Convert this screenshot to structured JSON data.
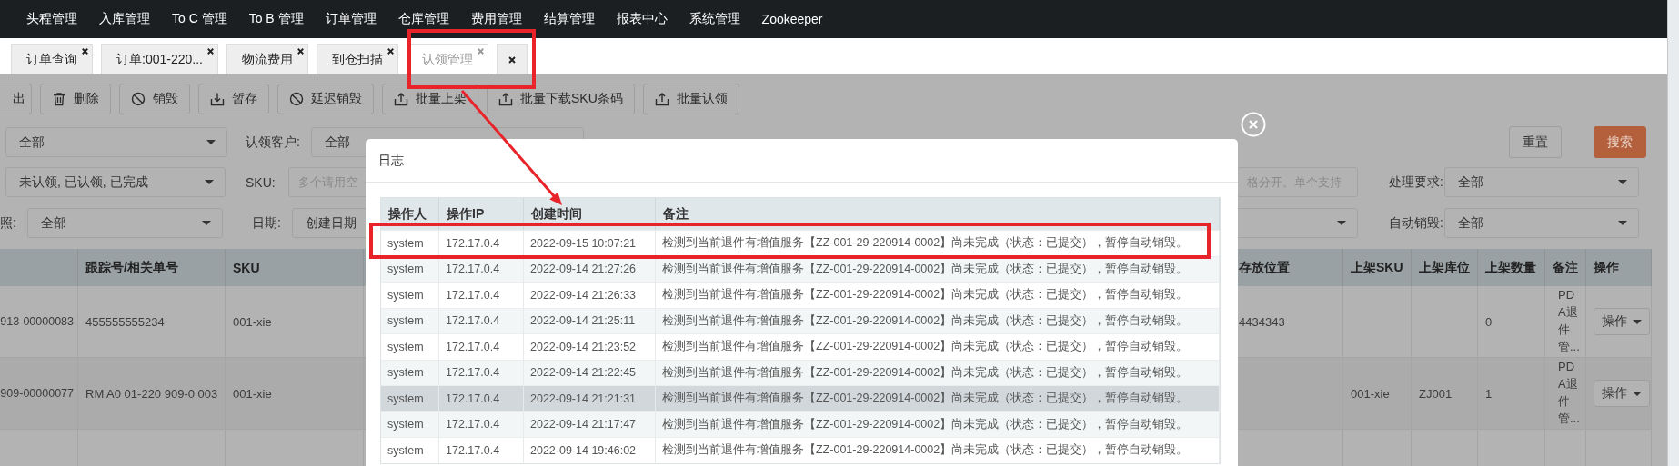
{
  "nav": {
    "items": [
      "头程管理",
      "入库管理",
      "To C 管理",
      "To B 管理",
      "订单管理",
      "仓库管理",
      "费用管理",
      "结算管理",
      "报表中心",
      "系统管理",
      "Zookeeper"
    ]
  },
  "tabs": [
    {
      "label": "订单查询",
      "selected": false
    },
    {
      "label": "订单:001-220...",
      "selected": false
    },
    {
      "label": "物流费用",
      "selected": false
    },
    {
      "label": "到仓扫描",
      "selected": false
    },
    {
      "label": "认领管理",
      "selected": true
    },
    {
      "selected": false
    }
  ],
  "toolbar": {
    "buttons": [
      {
        "label": "出",
        "kind": "plain"
      },
      {
        "label": "删除",
        "kind": "trash"
      },
      {
        "label": "销毁",
        "kind": "ban"
      },
      {
        "label": "暂存",
        "kind": "download"
      },
      {
        "label": "延迟销毁",
        "kind": "ban"
      },
      {
        "label": "批量上架",
        "kind": "upload"
      },
      {
        "label": "批量下载SKU条码",
        "kind": "upload"
      },
      {
        "label": "批量认领",
        "kind": "upload"
      }
    ]
  },
  "filters": {
    "status_select": "全部",
    "claim_customer": {
      "label": "认领客户:",
      "value": "全部"
    },
    "reset_button": "重置",
    "search_button": "搜索",
    "claim_state_select": "未认领, 已认领, 已完成",
    "sku": {
      "label": "SKU:",
      "placeholder": "多个请用空"
    },
    "keyword_field": {
      "placeholder": "格分开。单个支持"
    },
    "processing": {
      "label": "处理要求:",
      "value": "全部"
    },
    "column_3_label": "照:",
    "column_3_select": "全部",
    "date": {
      "label": "日期:",
      "value": "创建日期"
    },
    "auto_destroy": {
      "label": "自动销毁:",
      "value": "全部"
    }
  },
  "table": {
    "columns": [
      "跟踪号/相关单号",
      "SKU",
      "存放位置",
      "上架SKU",
      "上架库位",
      "上架数量",
      "备注",
      "操作"
    ],
    "rows": [
      {
        "column_1": "913-00000083",
        "tracking_no": "455555555234",
        "sku": "001-xie",
        "location": "4434343",
        "shelf_qty": "0",
        "note": "PDA退件管...",
        "action": "操作"
      },
      {
        "column_1": "909-00000077",
        "tracking_no": "RM A0 01-220 909-0 003",
        "sku": "001-xie",
        "shelf_sku": "001-xie",
        "shelf_bin": "ZJ001",
        "shelf_qty": "1",
        "note": "PDA退件管...",
        "action": "操作"
      }
    ]
  },
  "log": {
    "title": "日志",
    "columns": [
      "操作人",
      "操作IP",
      "创建时间",
      "备注"
    ],
    "rows": [
      {
        "operator": "system",
        "ip": "172.17.0.4",
        "time": "2022-09-15 10:07:21",
        "note": "检测到当前退件有增值服务【ZZ-001-29-220914-0002】尚未完成（状态：已提交），暂停自动销毁。",
        "hovered": false
      },
      {
        "operator": "system",
        "ip": "172.17.0.4",
        "time": "2022-09-14 21:27:26",
        "note": "检测到当前退件有增值服务【ZZ-001-29-220914-0002】尚未完成（状态：已提交），暂停自动销毁。",
        "hovered": false
      },
      {
        "operator": "system",
        "ip": "172.17.0.4",
        "time": "2022-09-14 21:26:33",
        "note": "检测到当前退件有增值服务【ZZ-001-29-220914-0002】尚未完成（状态：已提交），暂停自动销毁。",
        "hovered": false
      },
      {
        "operator": "system",
        "ip": "172.17.0.4",
        "time": "2022-09-14 21:25:11",
        "note": "检测到当前退件有增值服务【ZZ-001-29-220914-0002】尚未完成（状态：已提交），暂停自动销毁。",
        "hovered": false
      },
      {
        "operator": "system",
        "ip": "172.17.0.4",
        "time": "2022-09-14 21:23:52",
        "note": "检测到当前退件有增值服务【ZZ-001-29-220914-0002】尚未完成（状态：已提交），暂停自动销毁。",
        "hovered": false
      },
      {
        "operator": "system",
        "ip": "172.17.0.4",
        "time": "2022-09-14 21:22:45",
        "note": "检测到当前退件有增值服务【ZZ-001-29-220914-0002】尚未完成（状态：已提交），暂停自动销毁。",
        "hovered": false
      },
      {
        "operator": "system",
        "ip": "172.17.0.4",
        "time": "2022-09-14 21:21:31",
        "note": "检测到当前退件有增值服务【ZZ-001-29-220914-0002】尚未完成（状态：已提交），暂停自动销毁。",
        "hovered": true
      },
      {
        "operator": "system",
        "ip": "172.17.0.4",
        "time": "2022-09-14 21:17:47",
        "note": "检测到当前退件有增值服务【ZZ-001-29-220914-0002】尚未完成（状态：已提交），暂停自动销毁。",
        "hovered": false
      },
      {
        "operator": "system",
        "ip": "172.17.0.4",
        "time": "2022-09-14 19:46:02",
        "note": "检测到当前退件有增值服务【ZZ-001-29-220914-0002】尚未完成（状态：已提交），暂停自动销毁。",
        "hovered": false
      }
    ]
  }
}
